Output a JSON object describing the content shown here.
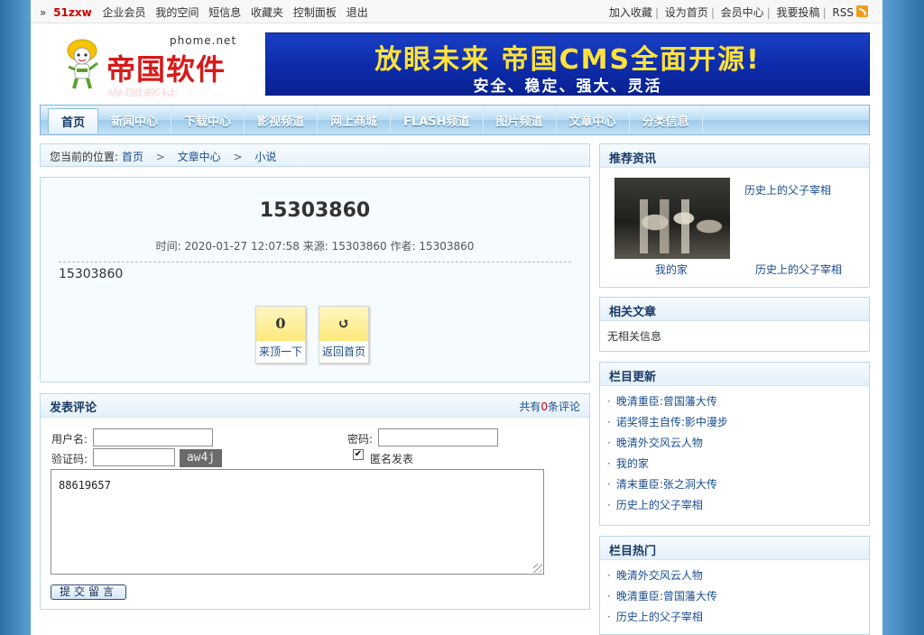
{
  "topbar": {
    "arrow": "»",
    "username": "51zxw",
    "links": [
      "企业会员",
      "我的空间",
      "短信息",
      "收藏夹",
      "控制面板",
      "退出"
    ],
    "right_links": [
      "加入收藏",
      "设为首页",
      "会员中心",
      "我要投稿",
      "RSS"
    ]
  },
  "header": {
    "site_domain": "phome.net",
    "site_name": "帝国软件",
    "banner_line1": "放眼未来 帝国CMS全面开源!",
    "banner_line2": "安全、稳定、强大、灵活"
  },
  "nav": [
    "首页",
    "新闻中心",
    "下载中心",
    "影视频道",
    "网上商城",
    "FLASH频道",
    "图片频道",
    "文章中心",
    "分类信息"
  ],
  "breadcrumb": {
    "prefix": "您当前的位置:",
    "items": [
      "首页",
      "文章中心",
      "小说"
    ],
    "sep": ">"
  },
  "article": {
    "title": "15303860",
    "meta": "时间: 2020-01-27 12:07:58  来源: 15303860  作者: 15303860",
    "body": "15303860",
    "vote_count": "0",
    "vote_label": "来顶一下",
    "back_symbol": "↺",
    "back_label": "返回首页"
  },
  "comment": {
    "title": "发表评论",
    "count_prefix": "共有",
    "count": "0",
    "count_suffix": "条评论",
    "username_label": "用户名:",
    "password_label": "密码:",
    "captcha_label": "验证码:",
    "captcha_text": "aw4j",
    "anonymous_label": "匿名发表",
    "anonymous_checked": "✔",
    "content": "88619657",
    "submit_label": "提交留言"
  },
  "sidebar": {
    "recommend": {
      "title": "推荐资讯",
      "top_link": "历史上的父子宰相",
      "caption_left": "我的家",
      "caption_right": "历史上的父子宰相"
    },
    "related": {
      "title": "相关文章",
      "empty": "无相关信息"
    },
    "updates": {
      "title": "栏目更新",
      "items": [
        "晚清重臣:曾国藩大传",
        "诺奖得主自传:影中漫步",
        "晚清外交风云人物",
        "我的家",
        "清末重臣:张之洞大传",
        "历史上的父子宰相"
      ]
    },
    "hot": {
      "title": "栏目热门",
      "items": [
        "晚清外交风云人物",
        "晚清重臣:曾国藩大传",
        "历史上的父子宰相"
      ]
    }
  },
  "colors": {
    "accent": "#1a4d8f",
    "brand_red": "#d61a1a",
    "border": "#bcd9ef"
  }
}
